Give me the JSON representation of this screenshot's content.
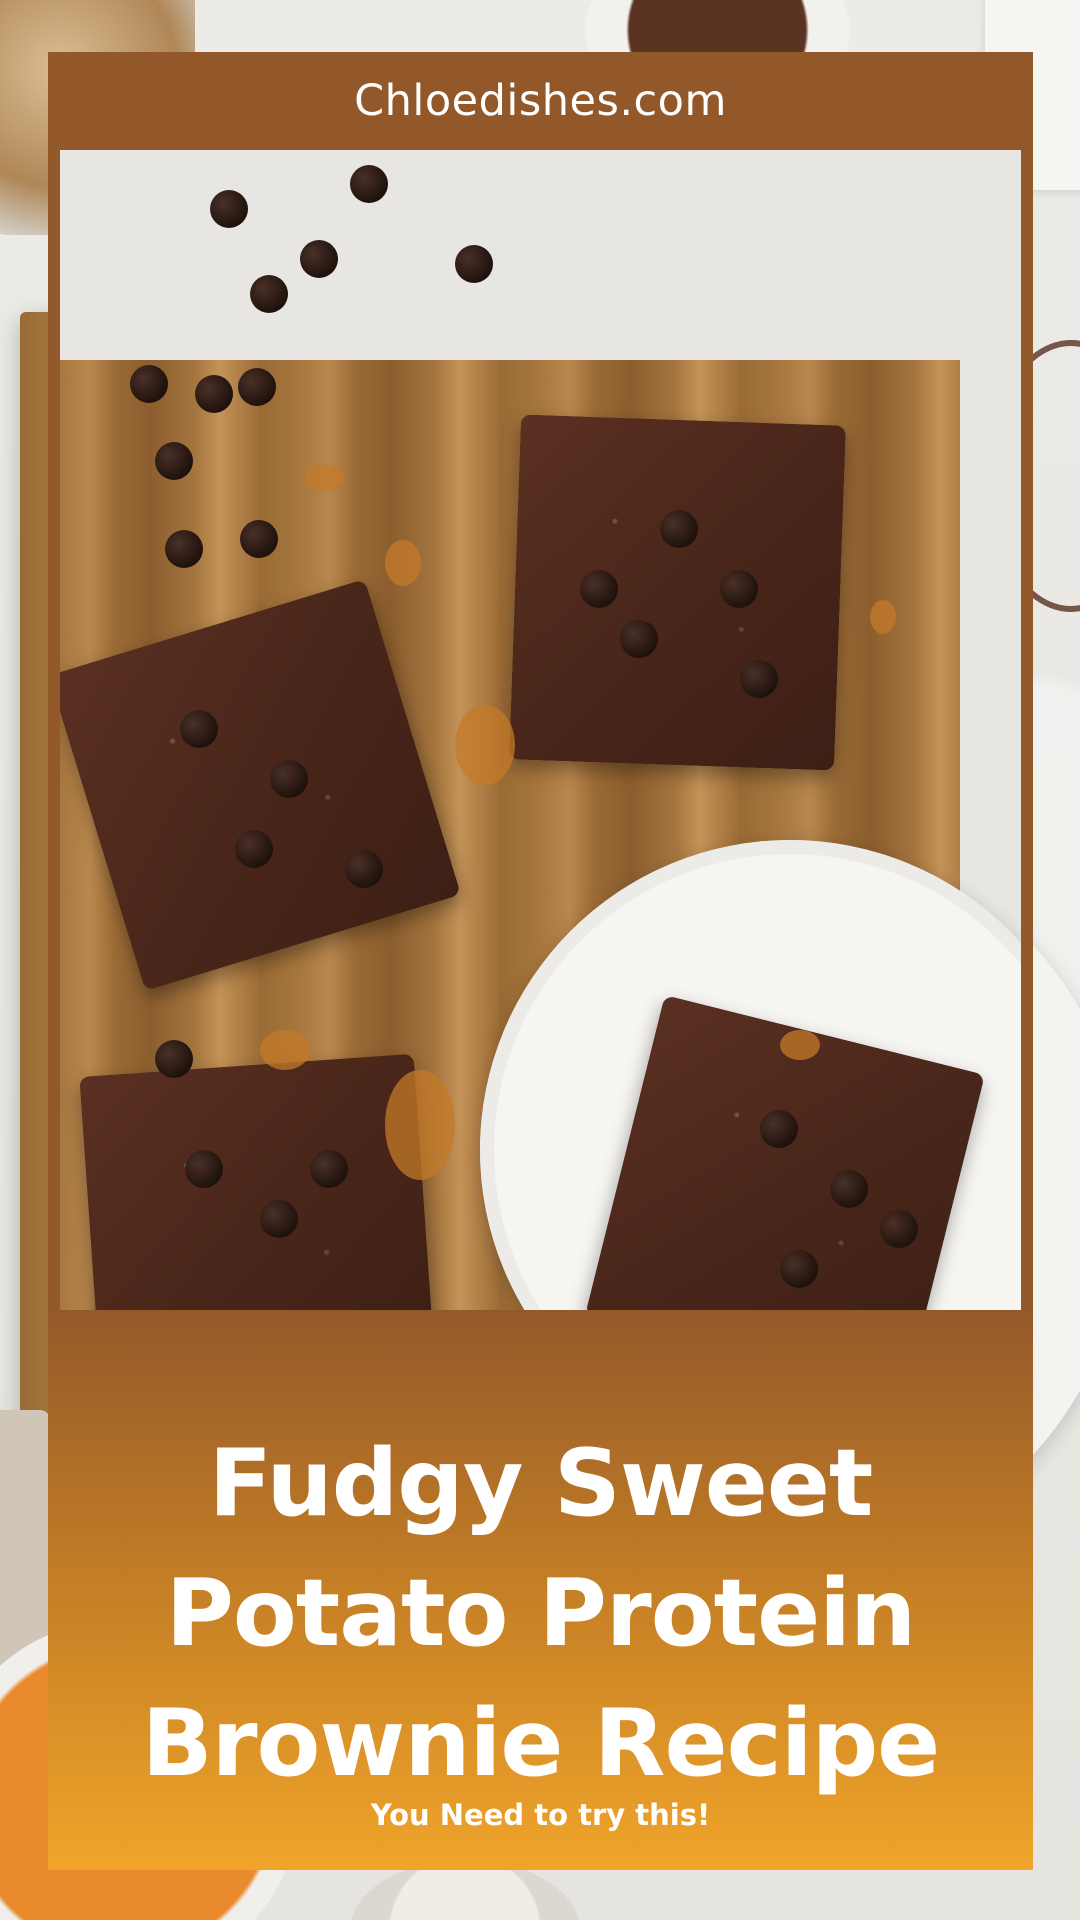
{
  "header": {
    "site_name": "Chloedishes.com"
  },
  "hero": {
    "title_line_1": "Fudgy Sweet",
    "title_line_2": "Potato Protein",
    "title_line_3": "Brownie Recipe",
    "tagline": "You Need to try this!"
  },
  "colors": {
    "card_brown": "#93592a",
    "gradient_bottom": "#f0a42a",
    "text": "#ffffff"
  }
}
